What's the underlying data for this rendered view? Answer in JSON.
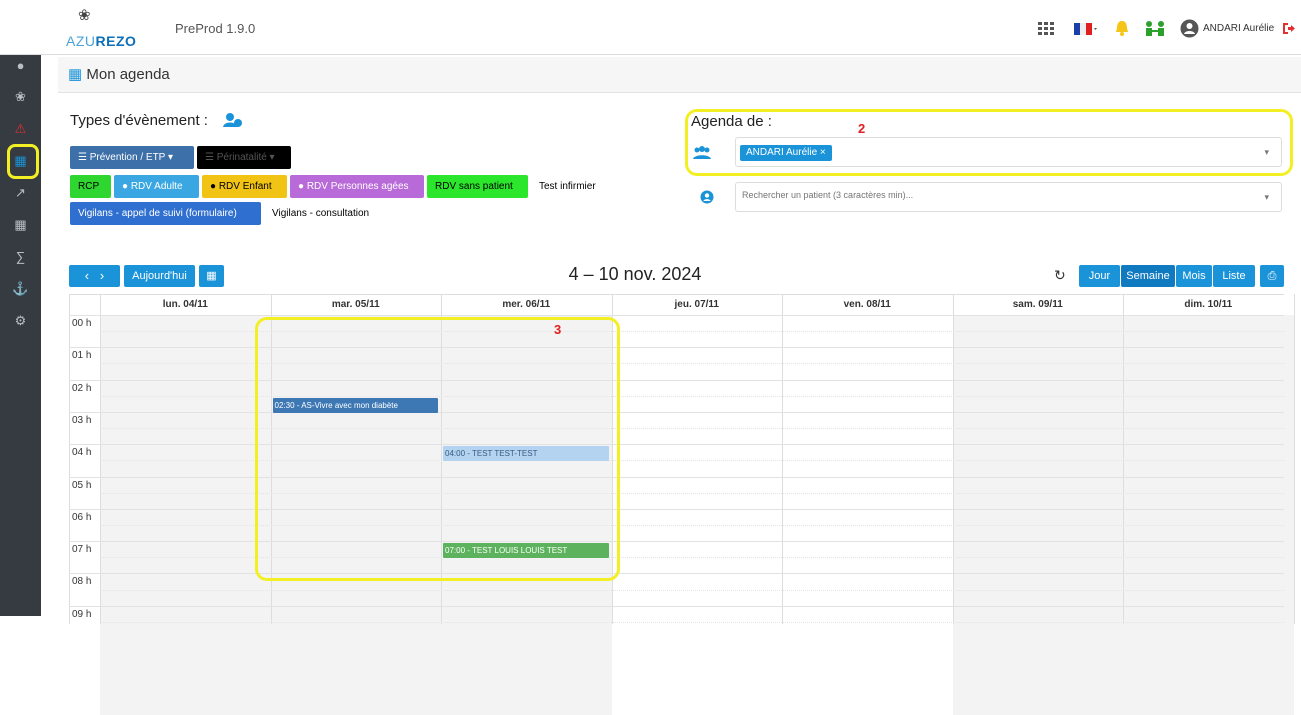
{
  "app": {
    "logo_text_prefix": "AZU",
    "logo_text_suffix": "REZO",
    "version": "PreProd 1.9.0"
  },
  "header": {
    "user_name": "ANDARI Aurélie"
  },
  "page": {
    "title": "Mon agenda"
  },
  "event_types": {
    "label": "Types d'évènement :",
    "dropdowns": [
      "Prévention / ETP",
      "Périnatalité"
    ],
    "tags": [
      {
        "label": "RCP",
        "color": "#2fd62f"
      },
      {
        "label": "RDV Adulte",
        "color": "#3aa7e3"
      },
      {
        "label": "RDV Enfant",
        "color": "#f1c315"
      },
      {
        "label": "RDV Personnes agées",
        "color": "#b96ad9"
      },
      {
        "label": "RDV sans patient",
        "color": "#2be62b"
      },
      {
        "label": "Test infirmier",
        "color": "#ffffff"
      },
      {
        "label": "Vigilans - appel de suivi (formulaire)",
        "color": "#2f6fcf"
      },
      {
        "label": "Vigilans - consultation",
        "color": "#ffffff"
      }
    ]
  },
  "agenda": {
    "label": "Agenda de :",
    "selected_user": "ANDARI Aurélie",
    "patient_placeholder": "Rechercher un patient (3 caractères min)..."
  },
  "annotations": [
    "2",
    "3"
  ],
  "calendar": {
    "title": "4 – 10 nov. 2024",
    "today_label": "Aujourd'hui",
    "views": [
      "Jour",
      "Semaine",
      "Mois",
      "Liste"
    ],
    "days": [
      "lun. 04/11",
      "mar. 05/11",
      "mer. 06/11",
      "jeu. 07/11",
      "ven. 08/11",
      "sam. 09/11",
      "dim. 10/11"
    ],
    "hours": [
      "00 h",
      "01 h",
      "02 h",
      "03 h",
      "04 h",
      "05 h",
      "06 h",
      "07 h",
      "08 h",
      "09 h"
    ],
    "events": [
      {
        "label": "02:30 - AS-Vivre avec mon diabète",
        "day": 1,
        "start": 2.5,
        "color": "#3d78b5"
      },
      {
        "label": "04:00 - TEST TEST-TEST",
        "day": 2,
        "start": 4.0,
        "color": "#b3d3f1"
      },
      {
        "label": "07:00 - TEST LOUIS LOUIS TEST",
        "day": 2,
        "start": 7.0,
        "color": "#5db35d"
      }
    ]
  }
}
